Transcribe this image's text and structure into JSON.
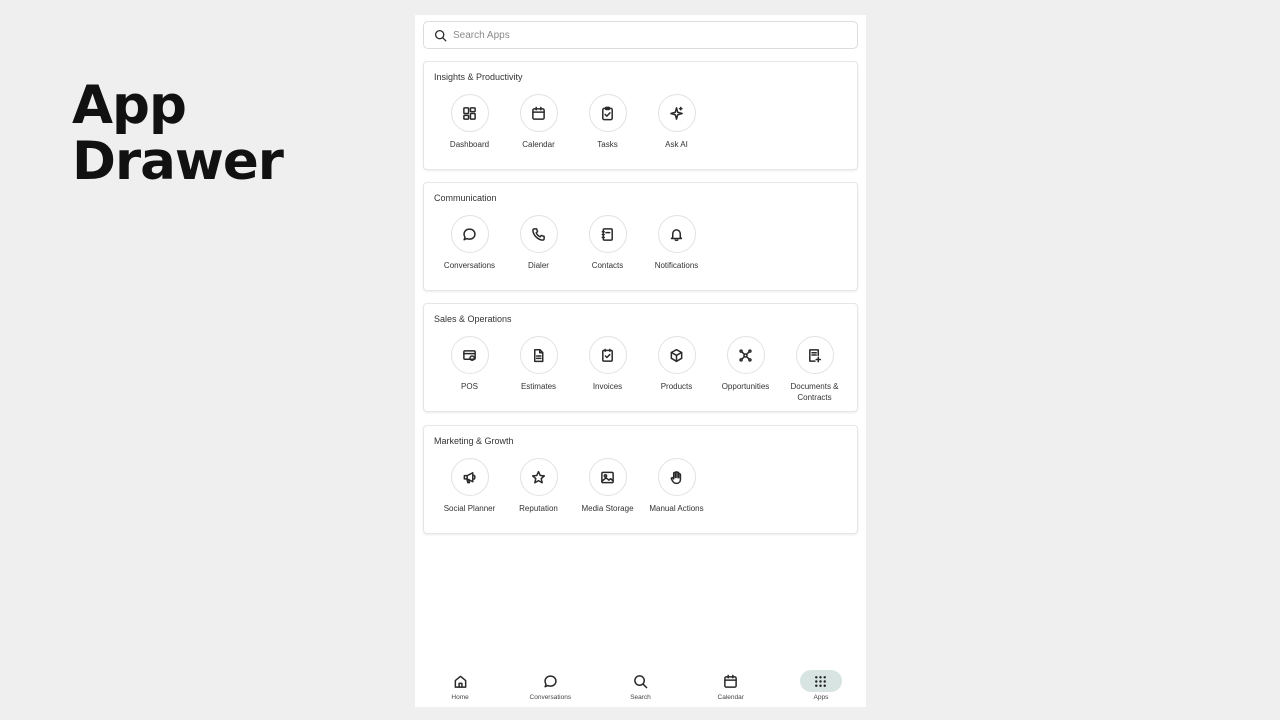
{
  "hero": {
    "line1": "App",
    "line2": "Drawer"
  },
  "search": {
    "placeholder": "Search Apps"
  },
  "sections": [
    {
      "title": "Insights & Productivity",
      "apps": [
        {
          "label": "Dashboard",
          "icon": "dashboard-icon"
        },
        {
          "label": "Calendar",
          "icon": "calendar-icon"
        },
        {
          "label": "Tasks",
          "icon": "tasks-icon"
        },
        {
          "label": "Ask AI",
          "icon": "sparkles-icon"
        }
      ]
    },
    {
      "title": "Communication",
      "apps": [
        {
          "label": "Conversations",
          "icon": "chat-bubble-icon"
        },
        {
          "label": "Dialer",
          "icon": "phone-icon"
        },
        {
          "label": "Contacts",
          "icon": "contacts-icon"
        },
        {
          "label": "Notifications",
          "icon": "bell-icon"
        }
      ]
    },
    {
      "title": "Sales & Operations",
      "apps": [
        {
          "label": "POS",
          "icon": "pos-icon"
        },
        {
          "label": "Estimates",
          "icon": "document-icon"
        },
        {
          "label": "Invoices",
          "icon": "invoice-icon"
        },
        {
          "label": "Products",
          "icon": "box-icon"
        },
        {
          "label": "Opportunities",
          "icon": "opportunities-icon"
        },
        {
          "label": "Documents & Contracts",
          "icon": "documents-icon"
        }
      ]
    },
    {
      "title": "Marketing & Growth",
      "apps": [
        {
          "label": "Social Planner",
          "icon": "megaphone-icon"
        },
        {
          "label": "Reputation",
          "icon": "star-icon"
        },
        {
          "label": "Media Storage",
          "icon": "image-icon"
        },
        {
          "label": "Manual Actions",
          "icon": "hand-icon"
        }
      ]
    }
  ],
  "bottom_nav": [
    {
      "label": "Home",
      "icon": "home-icon",
      "active": false
    },
    {
      "label": "Conversations",
      "icon": "chat-bubble-icon",
      "active": false
    },
    {
      "label": "Search",
      "icon": "search-icon",
      "active": false
    },
    {
      "label": "Calendar",
      "icon": "calendar-icon",
      "active": false
    },
    {
      "label": "Apps",
      "icon": "grid-icon",
      "active": true
    }
  ],
  "colors": {
    "page_bg": "#efefef",
    "active_nav_bg": "#d7e4e2"
  }
}
